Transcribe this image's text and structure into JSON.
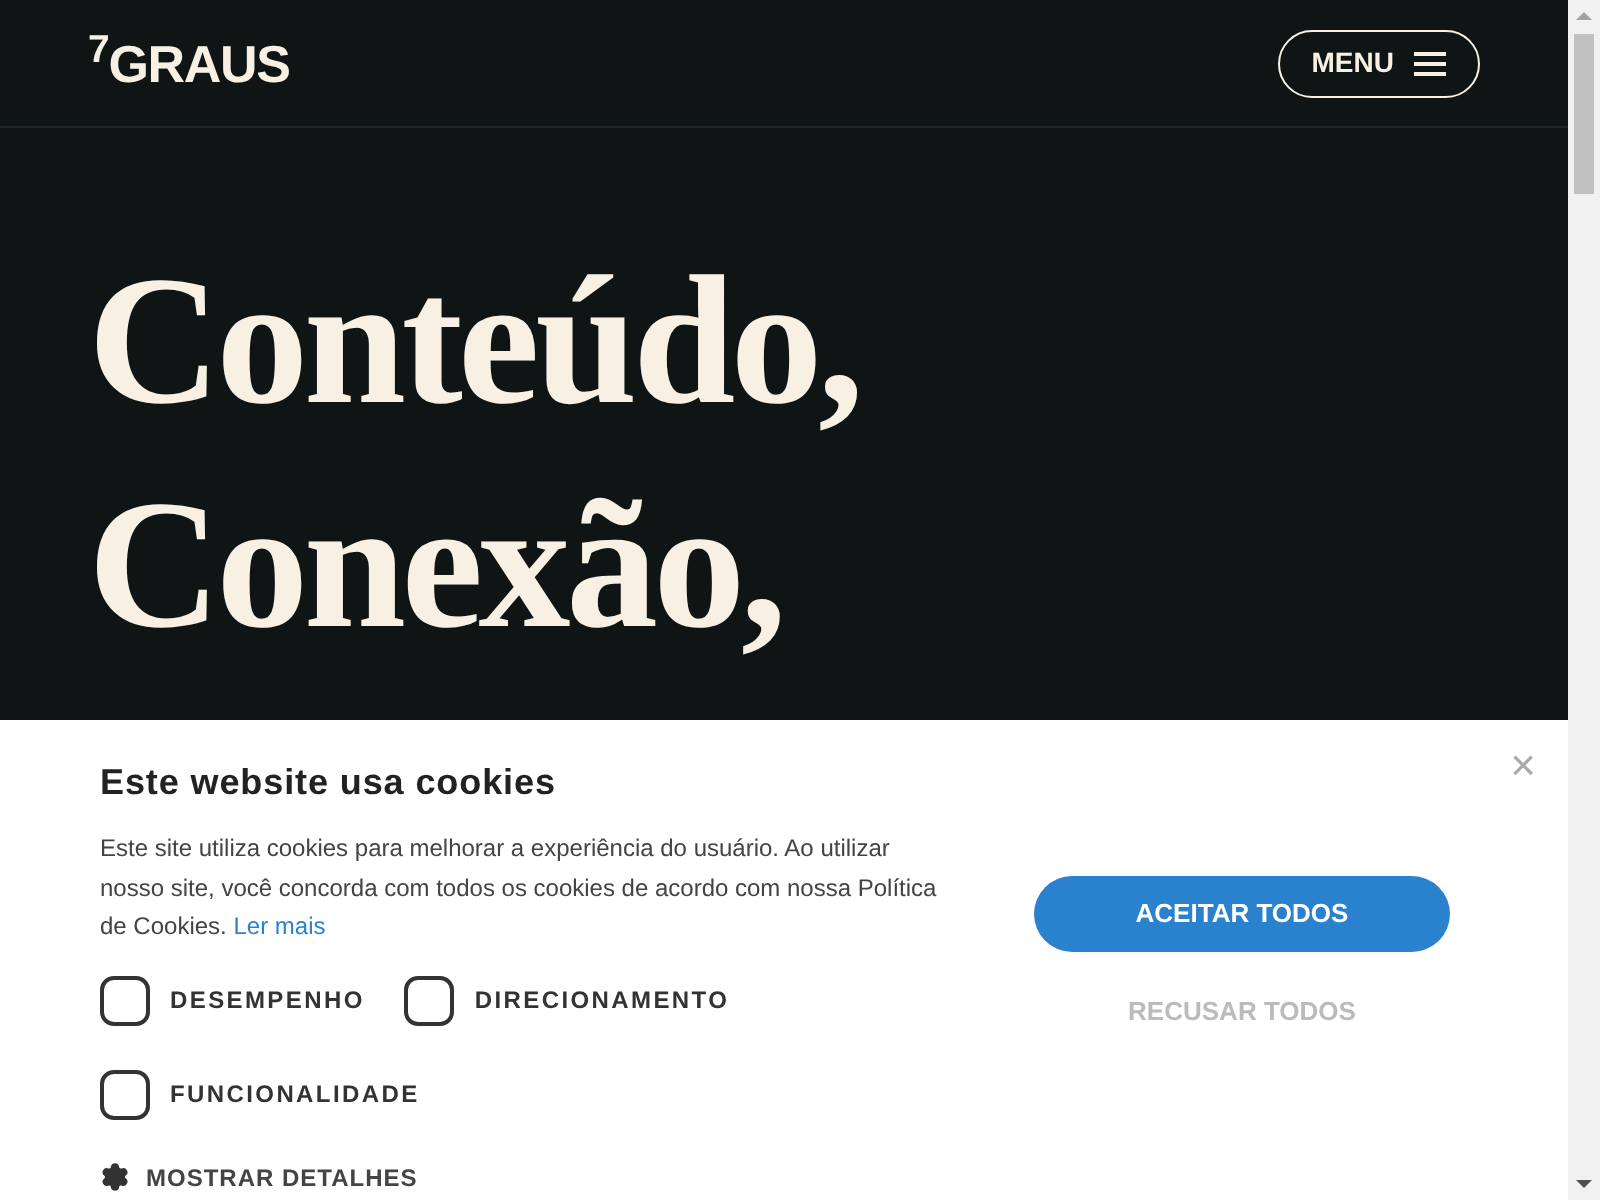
{
  "header": {
    "logo": "$^{7}$GRAUS",
    "menu_button": "MENU"
  },
  "hero": {
    "lines": [
      "Conteúdo,",
      "Conexão,"
    ]
  },
  "cookie_banner": {
    "title": "Este website usa cookies",
    "close": "×",
    "body": "Este site utiliza cookies para melhorar a experiência do usuário. Ao utilizar nosso site, você concorda com todos os cookies de acordo com nossa Política de Cookies.",
    "link": "Ler mais",
    "options": [
      {
        "label": "DESEMPENHO",
        "checked": false
      },
      {
        "label": "DIRECIONAMENTO",
        "checked": false
      },
      {
        "label": "FUNCIONALIDADE",
        "checked": false
      }
    ],
    "details": "MOSTRAR DETALHES",
    "accept": "ACEITAR TODOS",
    "reject": "RECUSAR TODOS"
  }
}
